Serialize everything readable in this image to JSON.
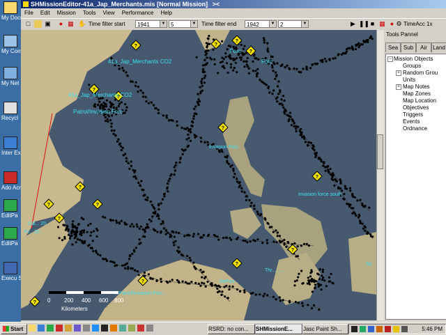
{
  "window": {
    "title": "SHMissionEditor-41a_Jap_Merchants.mis [Normal Mission]",
    "title_suffix": "><"
  },
  "menu": [
    "File",
    "Edit",
    "Mission",
    "Tools",
    "View",
    "Performance",
    "Help"
  ],
  "toolbar": {
    "filter_start_label": "Time filter start",
    "start_year": "1941",
    "start_month": "5",
    "filter_end_label": "Time filter end",
    "end_year": "1942",
    "end_month": "2",
    "time_accel": "TimeAcc 1x"
  },
  "tools_panel": {
    "title": "Tools Pannel",
    "tabs": [
      "Sea",
      "Sub",
      "Air",
      "Land"
    ],
    "tree_root": "Mission Objects",
    "tree_items": [
      "Groups",
      "Random Grou",
      "Units",
      "Map Notes",
      "Map Zones",
      "Map Location",
      "Objectives",
      "Triggers",
      "Events",
      "Ordnance"
    ]
  },
  "map": {
    "labels": [
      "41a_Jap_Merchants CO2",
      "41a_Jap_Merchants CO2",
      "Patrol/Invasion Forc",
      "Forc",
      "Forc",
      "Invasion Forc",
      "Invasion force south",
      "Cal... 20 .",
      "Ft... 20 . ",
      "DePas...",
      "So",
      "Thr.... ....",
      "...Patrol/Invasion Forc..."
    ],
    "scale_ticks": [
      "0",
      "200",
      "400",
      "600",
      "800"
    ],
    "scale_unit": "Kilometers"
  },
  "desktop_icons": [
    "My Docu",
    "My Com",
    "My Net Places",
    "Recycl",
    "Inter Explo",
    "Ado Acroba",
    "EditPa",
    "EditPa",
    "Execu Softw"
  ],
  "taskbar": {
    "start": "Start",
    "tasks": [
      "RSRD: no con...",
      "SHMissionE...",
      "Jasc Paint Sh..."
    ],
    "clock": "5:46 PM"
  },
  "colors": {
    "titlebar": "#0a246a",
    "sea": "#47596e",
    "land": "#c9b98f",
    "label": "#3ee0f2",
    "marker": "#f2e200"
  }
}
